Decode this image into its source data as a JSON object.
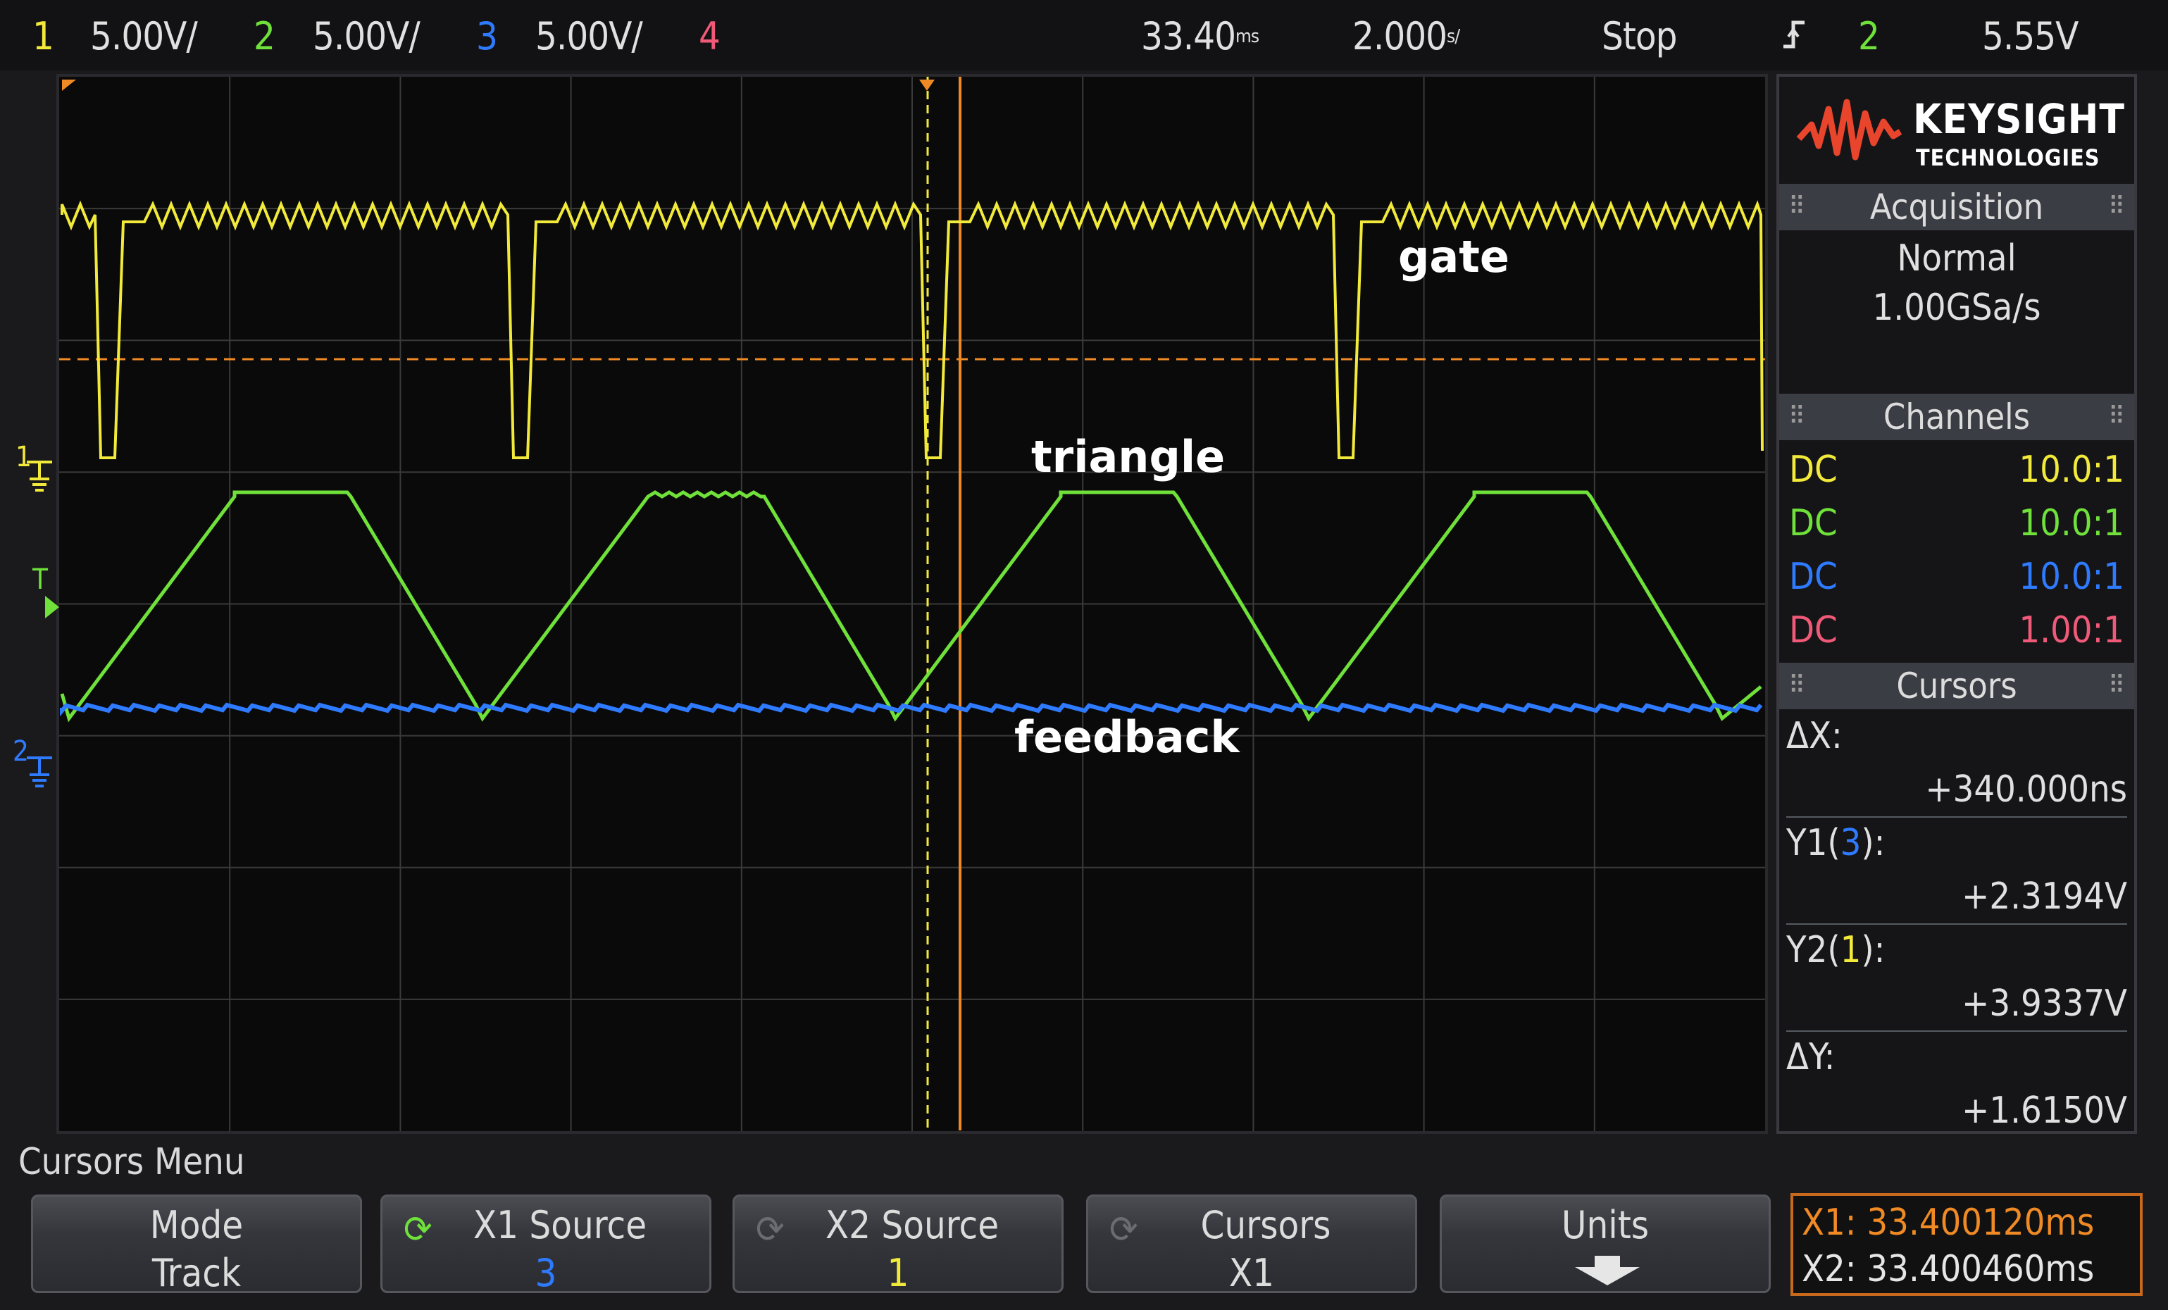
{
  "status_bar": {
    "ch1_num": "1",
    "ch1_scale": "5.00V/",
    "ch2_num": "2",
    "ch2_scale": "5.00V/",
    "ch3_num": "3",
    "ch3_scale": "5.00V/",
    "ch4_num": "4",
    "time_position": "33.40",
    "time_position_unit": "ms",
    "timebase": "2.000",
    "timebase_unit": "s/",
    "run_state": "Stop",
    "trigger_icon": "edge-trigger-icon",
    "trigger_source": "2",
    "trigger_level": "5.55V"
  },
  "colors": {
    "ch1": "#f2ea3a",
    "ch2": "#6fe13a",
    "ch3": "#2f7bff",
    "ch4": "#f05a78",
    "cursor": "#f08a24",
    "grid": "#3a3a3a"
  },
  "waveform_labels": {
    "gate": "gate",
    "triangle": "triangle",
    "feedback": "feedback"
  },
  "markers": {
    "ch1": "1",
    "trigger": "T",
    "ch2": "2"
  },
  "brand": {
    "name": "KEYSIGHT",
    "sub": "TECHNOLOGIES"
  },
  "acquisition": {
    "header": "Acquisition",
    "mode": "Normal",
    "rate": "1.00GSa/s"
  },
  "channels": {
    "header": "Channels",
    "rows": [
      {
        "coupling": "DC",
        "probe": "10.0:1"
      },
      {
        "coupling": "DC",
        "probe": "10.0:1"
      },
      {
        "coupling": "DC",
        "probe": "10.0:1"
      },
      {
        "coupling": "DC",
        "probe": "1.00:1"
      }
    ]
  },
  "cursors": {
    "header": "Cursors",
    "dx_label": "ΔX:",
    "dx_value": "+340.000ns",
    "y1_label": "Y1(",
    "y1_src": "3",
    "y1_close": "):",
    "y1_value": "+2.3194V",
    "y2_label": "Y2(",
    "y2_src": "1",
    "y2_close": "):",
    "y2_value": "+3.9337V",
    "dy_label": "ΔY:",
    "dy_value": "+1.6150V"
  },
  "softkeys": {
    "menu_title": "Cursors Menu",
    "mode_label": "Mode",
    "mode_value": "Track",
    "x1_label": "X1 Source",
    "x1_value": "3",
    "x2_label": "X2 Source",
    "x2_value": "1",
    "cursors_label": "Cursors",
    "cursors_value": "X1",
    "units_label": "Units"
  },
  "readout": {
    "x1": "X1: 33.400120ms",
    "x2": "X2: 33.400460ms"
  }
}
